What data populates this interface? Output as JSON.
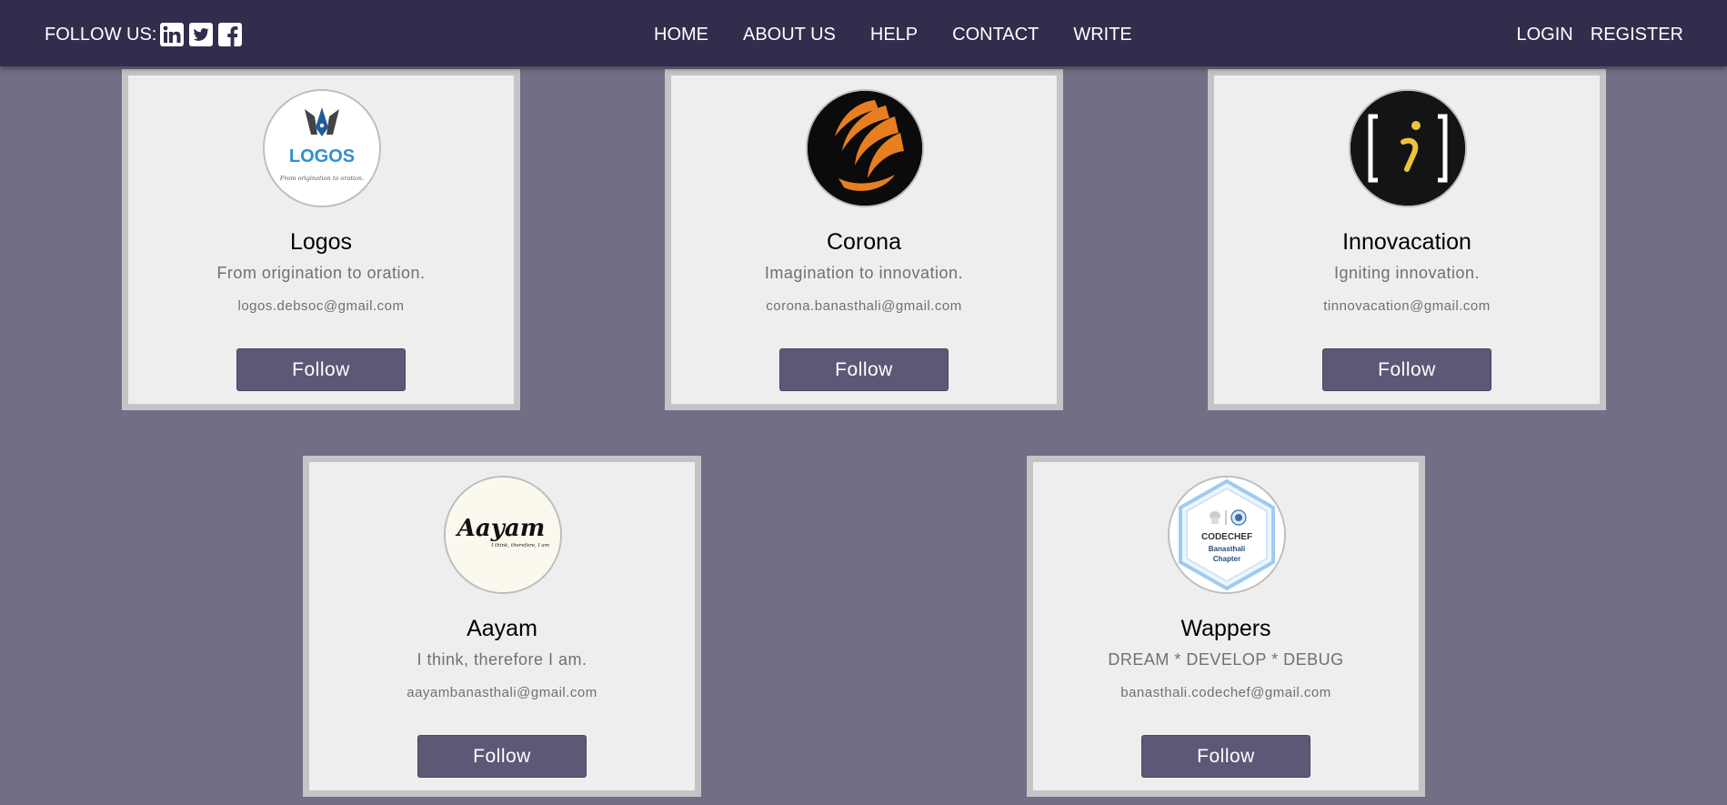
{
  "header": {
    "follow_label": "FOLLOW US:",
    "social": [
      "linkedin-icon",
      "twitter-icon",
      "facebook-icon"
    ],
    "nav": [
      {
        "label": "HOME"
      },
      {
        "label": "ABOUT US"
      },
      {
        "label": "HELP"
      },
      {
        "label": "CONTACT"
      },
      {
        "label": "WRITE"
      }
    ],
    "login_label": "LOGIN",
    "register_label": "REGISTER"
  },
  "cards": [
    {
      "name": "Logos",
      "tagline": "From origination to oration.",
      "email": "logos.debsoc@gmail.com",
      "button": "Follow",
      "logo": {
        "text": "LOGOS",
        "subtext": "From origination to oration.",
        "color": "#2f8fd1"
      }
    },
    {
      "name": "Corona",
      "tagline": "Imagination to innovation.",
      "email": "corona.banasthali@gmail.com",
      "button": "Follow",
      "logo": {
        "color": "#e77e22"
      }
    },
    {
      "name": "Innovacation",
      "tagline": "Igniting innovation.",
      "email": "tinnovacation@gmail.com",
      "button": "Follow",
      "logo": {
        "text": "i",
        "color": "#e8c53a"
      }
    },
    {
      "name": "Aayam",
      "tagline": "I think, therefore I am.",
      "email": "aayambanasthali@gmail.com",
      "button": "Follow",
      "logo": {
        "text": "Aayam",
        "subtext": "I think, therefore, I am"
      }
    },
    {
      "name": "Wappers",
      "tagline": "DREAM * DEVELOP * DEBUG",
      "email": "banasthali.codechef@gmail.com",
      "button": "Follow",
      "logo": {
        "text": "CODECHEF",
        "subtext": "Banasthali",
        "subtext2": "Chapter",
        "color": "#9ecbf0"
      }
    }
  ],
  "colors": {
    "background": "#736e85",
    "navbar": "#332d4d",
    "card": "#eeeeee",
    "card_border": "#c4c3c6",
    "button": "#5d5876"
  }
}
